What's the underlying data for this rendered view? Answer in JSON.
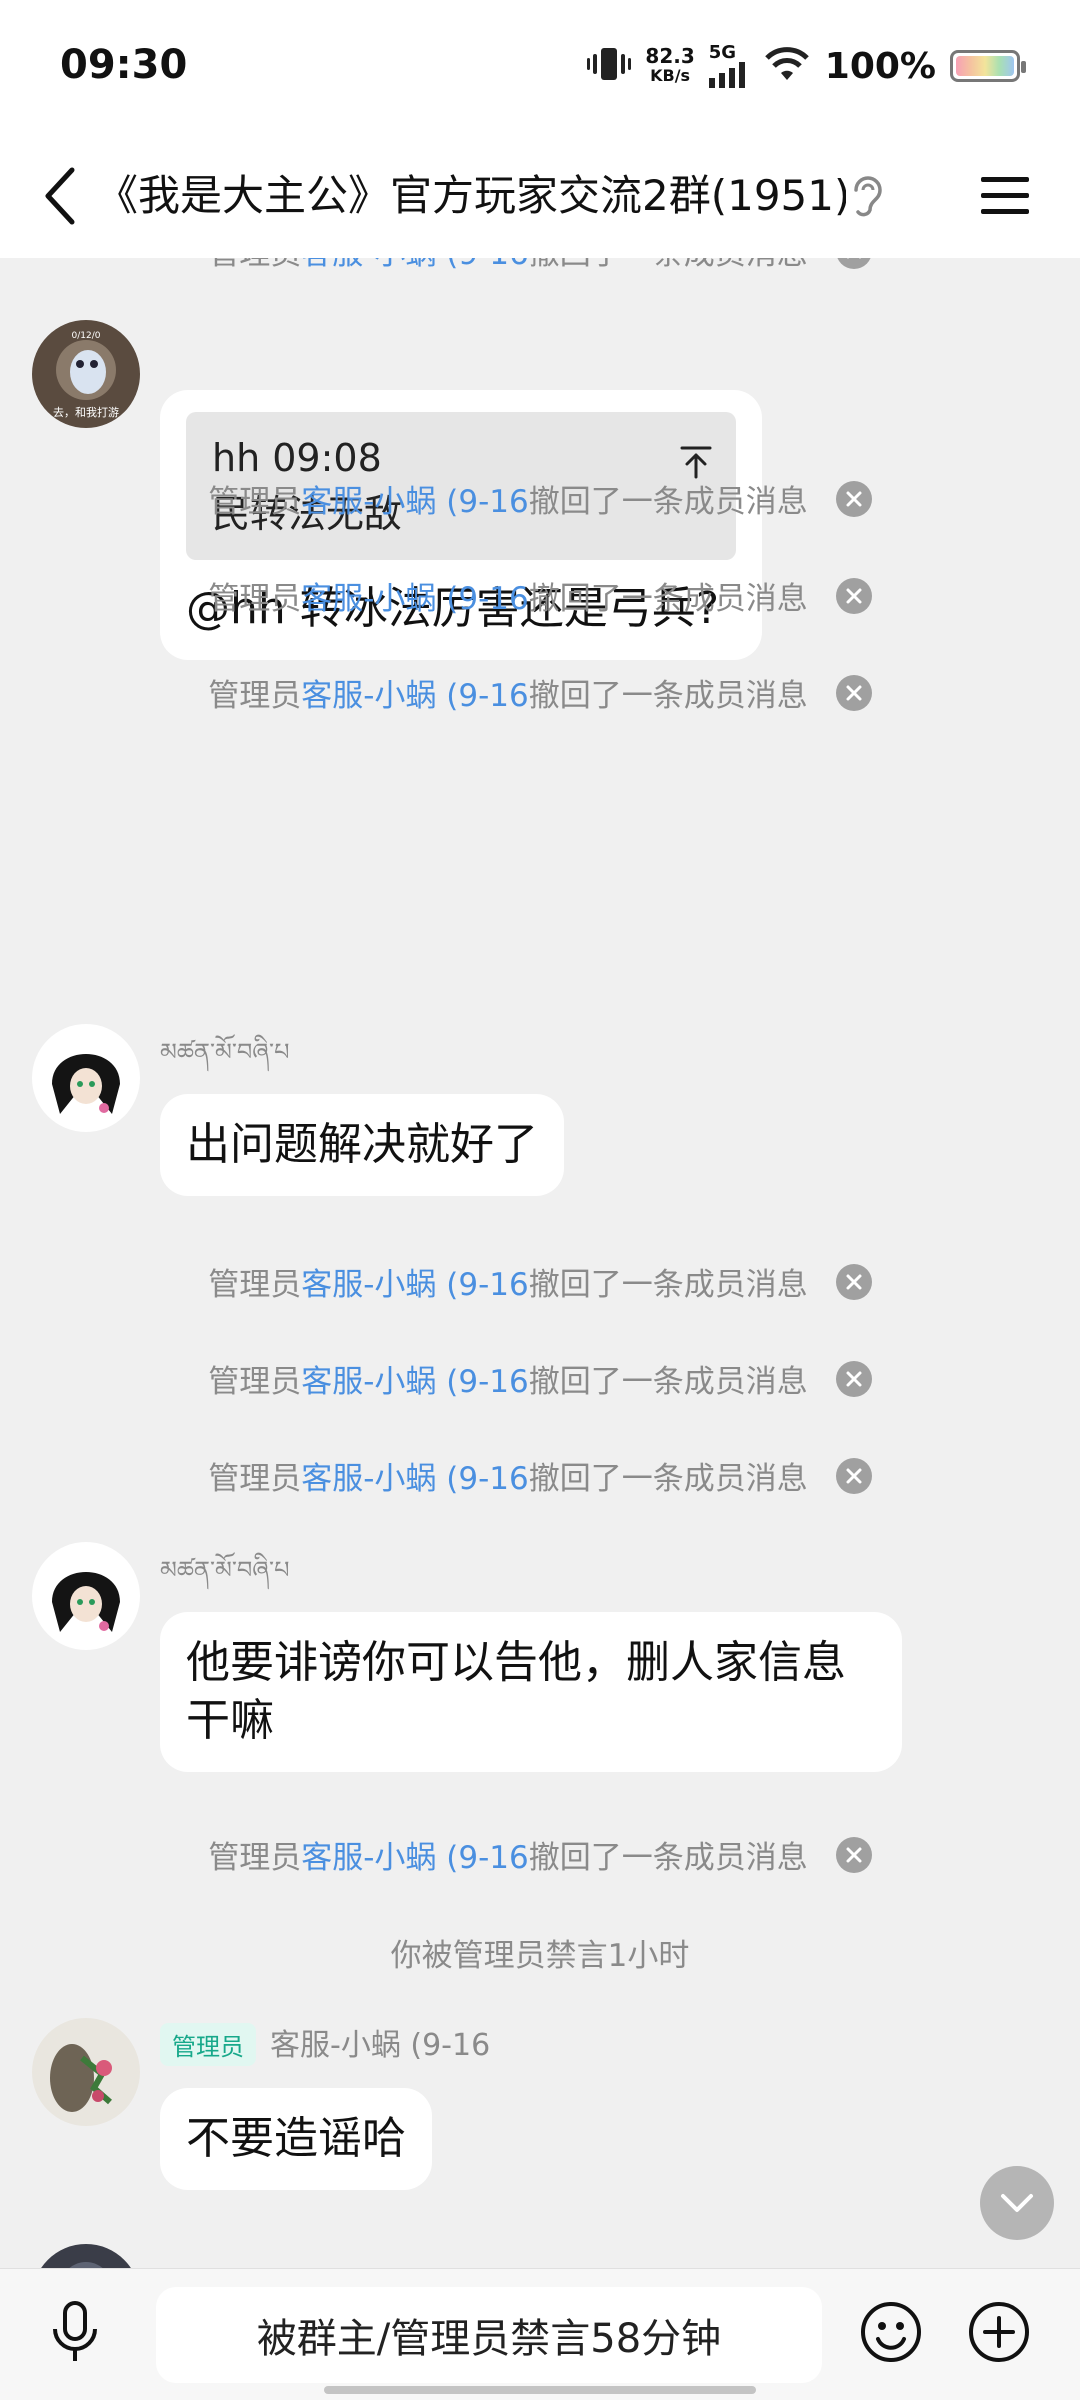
{
  "status_bar": {
    "time": "09:30",
    "net_speed_value": "82.3",
    "net_speed_unit": "KB/s",
    "network": "5G",
    "battery": "100%"
  },
  "header": {
    "title": "《我是大主公》官方玩家交流2群(1951)"
  },
  "messages": {
    "m1": {
      "quote_sender_time": "hh 09:08",
      "quote_text": "民转法无敌",
      "text": "@hh 转冰法厉害还是弓兵?",
      "avatar_text_top": "0/12/0",
      "avatar_text_bottom": "去，和我打游"
    },
    "recall_prefix": "管理员",
    "recall_name": "客服-小蜗 (9-16",
    "recall_suffix": "撤回了一条成员消息",
    "m2": {
      "sender": "མཚན་མོ་བཞི་པ",
      "text": "出问题解决就好了"
    },
    "m3": {
      "sender": "མཚན་མོ་བཞི་པ",
      "text": "他要诽谤你可以告他，删人家信息干嘛"
    },
    "muted_notice": "你被管理员禁言1小时",
    "m4": {
      "badge": "管理员",
      "sender": "客服-小蜗 (9-16",
      "text": "不要造谣哈"
    }
  },
  "input_bar": {
    "placeholder": "被群主/管理员禁言58分钟"
  },
  "colors": {
    "link": "#4a8fe0",
    "admin_badge_bg": "#e1f7f1",
    "admin_badge_text": "#17a88a",
    "chat_bg": "#f0f0f0"
  }
}
